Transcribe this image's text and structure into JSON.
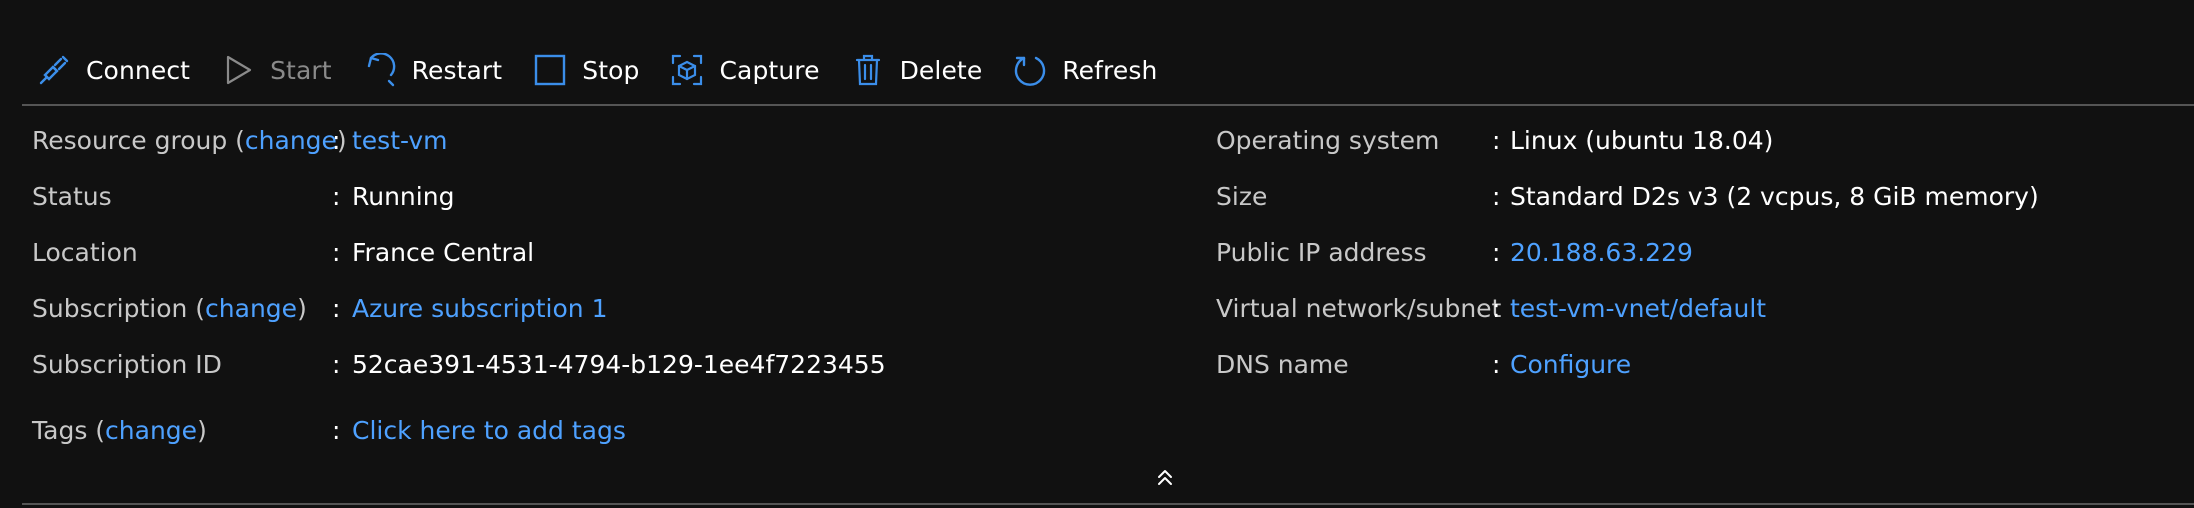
{
  "toolbar": {
    "connect": "Connect",
    "start": "Start",
    "restart": "Restart",
    "stop": "Stop",
    "capture": "Capture",
    "delete": "Delete",
    "refresh": "Refresh"
  },
  "left": {
    "resource_group": {
      "label_pre": "Resource group (",
      "change": "change",
      "label_post": ")",
      "value": "test-vm"
    },
    "status": {
      "label": "Status",
      "value": "Running"
    },
    "location": {
      "label": "Location",
      "value": "France Central"
    },
    "subscription": {
      "label_pre": "Subscription (",
      "change": "change",
      "label_post": ")",
      "value": "Azure subscription 1"
    },
    "subscription_id": {
      "label": "Subscription ID",
      "value": "52cae391-4531-4794-b129-1ee4f7223455"
    },
    "tags": {
      "label_pre": "Tags (",
      "change": "change",
      "label_post": ")",
      "value": "Click here to add tags"
    }
  },
  "right": {
    "os": {
      "label": "Operating system",
      "value": "Linux (ubuntu 18.04)"
    },
    "size": {
      "label": "Size",
      "value": "Standard D2s v3 (2 vcpus, 8 GiB memory)"
    },
    "public_ip": {
      "label": "Public IP address",
      "value": "20.188.63.229"
    },
    "vnet": {
      "label": "Virtual network/subnet",
      "value": "test-vm-vnet/default"
    },
    "dns": {
      "label": "DNS name",
      "value": "Configure"
    }
  },
  "colon": ":",
  "colors": {
    "background": "#111111",
    "link": "#4ea1ff",
    "text": "#ffffff",
    "label": "#c8c8c8",
    "disabled": "#8a8a8a",
    "icon_blue": "#3b8eea"
  },
  "icons": {
    "connect": "plug-icon",
    "start": "play-icon",
    "restart": "restart-icon",
    "stop": "stop-icon",
    "capture": "capture-icon",
    "delete": "trash-icon",
    "refresh": "refresh-icon",
    "collapse": "double-chevron-up-icon"
  }
}
